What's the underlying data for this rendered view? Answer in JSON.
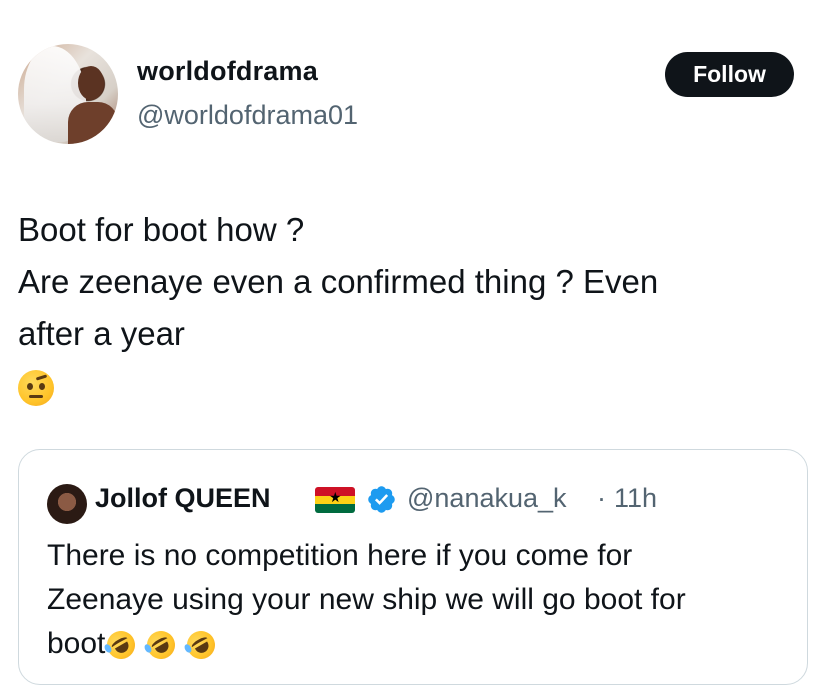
{
  "author": {
    "display_name": "worldofdrama",
    "handle": "@worldofdrama01"
  },
  "follow_button": {
    "label": "Follow"
  },
  "tweet": {
    "lines": [
      "Boot for boot how ?",
      "Are zeenaye even a confirmed thing ? Even",
      "after a year"
    ],
    "emoji": "face-with-raised-eyebrow-icon"
  },
  "quoted_tweet": {
    "display_name": "Jollof QUEEN",
    "flag": "ghana-flag-icon",
    "verified": "verified-badge-icon",
    "handle": "@nanakua_k",
    "separator": "·",
    "time": "11h",
    "lines": [
      "There is no competition here if you come for",
      "Zeenaye using your new ship we will go boot for",
      "boot"
    ],
    "trailing_emojis": [
      "rolling-on-floor-laughing-icon",
      "rolling-on-floor-laughing-icon",
      "rolling-on-floor-laughing-icon"
    ]
  },
  "colors": {
    "text": "#0f1419",
    "secondary_text": "#536471",
    "follow_bg": "#0f1419",
    "border": "#cfd9de",
    "verified_blue": "#1d9bf0"
  }
}
